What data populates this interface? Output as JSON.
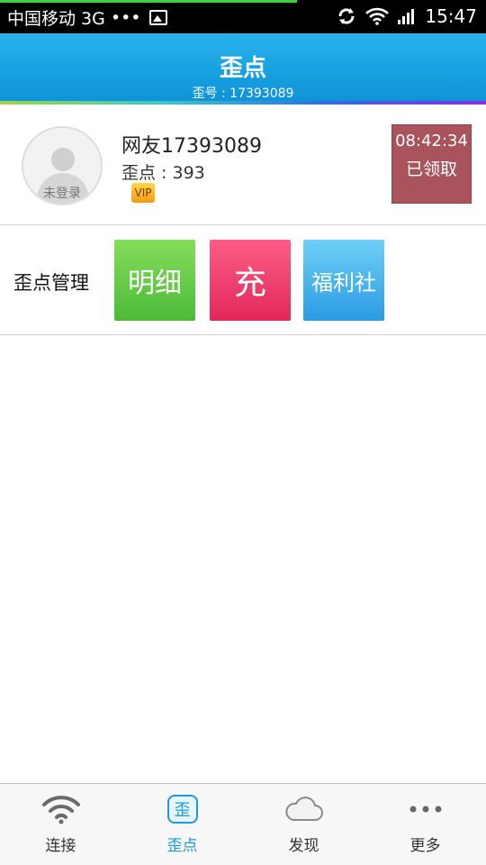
{
  "status_bar": {
    "carrier": "中国移动 3G",
    "dots": "•••",
    "time": "15:47",
    "icons": [
      "image-notification-icon",
      "sync-icon",
      "wifi-icon",
      "signal-icon"
    ]
  },
  "header": {
    "title": "歪点",
    "subtitle": "歪号 : 17393089",
    "color": "#1aa2e2"
  },
  "profile": {
    "avatar_label": "未登录",
    "username": "网友17393089",
    "points": "歪点 : 393",
    "vip_badge": "VIP",
    "checkin_time": "08:42:34",
    "checkin_status": "已领取"
  },
  "manage": {
    "label": "歪点管理",
    "tiles": [
      {
        "label": "明细",
        "color": "#5cc646"
      },
      {
        "label": "充",
        "color": "#ef3f6e"
      },
      {
        "label": "福利社",
        "color": "#3fb1ec"
      }
    ]
  },
  "bottom_nav": {
    "items": [
      {
        "label": "连接",
        "icon": "wifi-icon",
        "active": false
      },
      {
        "label": "歪点",
        "icon": "point-icon",
        "active": true
      },
      {
        "label": "发现",
        "icon": "cloud-icon",
        "active": false
      },
      {
        "label": "更多",
        "icon": "more-dots-icon",
        "active": false
      }
    ],
    "active_color": "#1a9ad8"
  }
}
